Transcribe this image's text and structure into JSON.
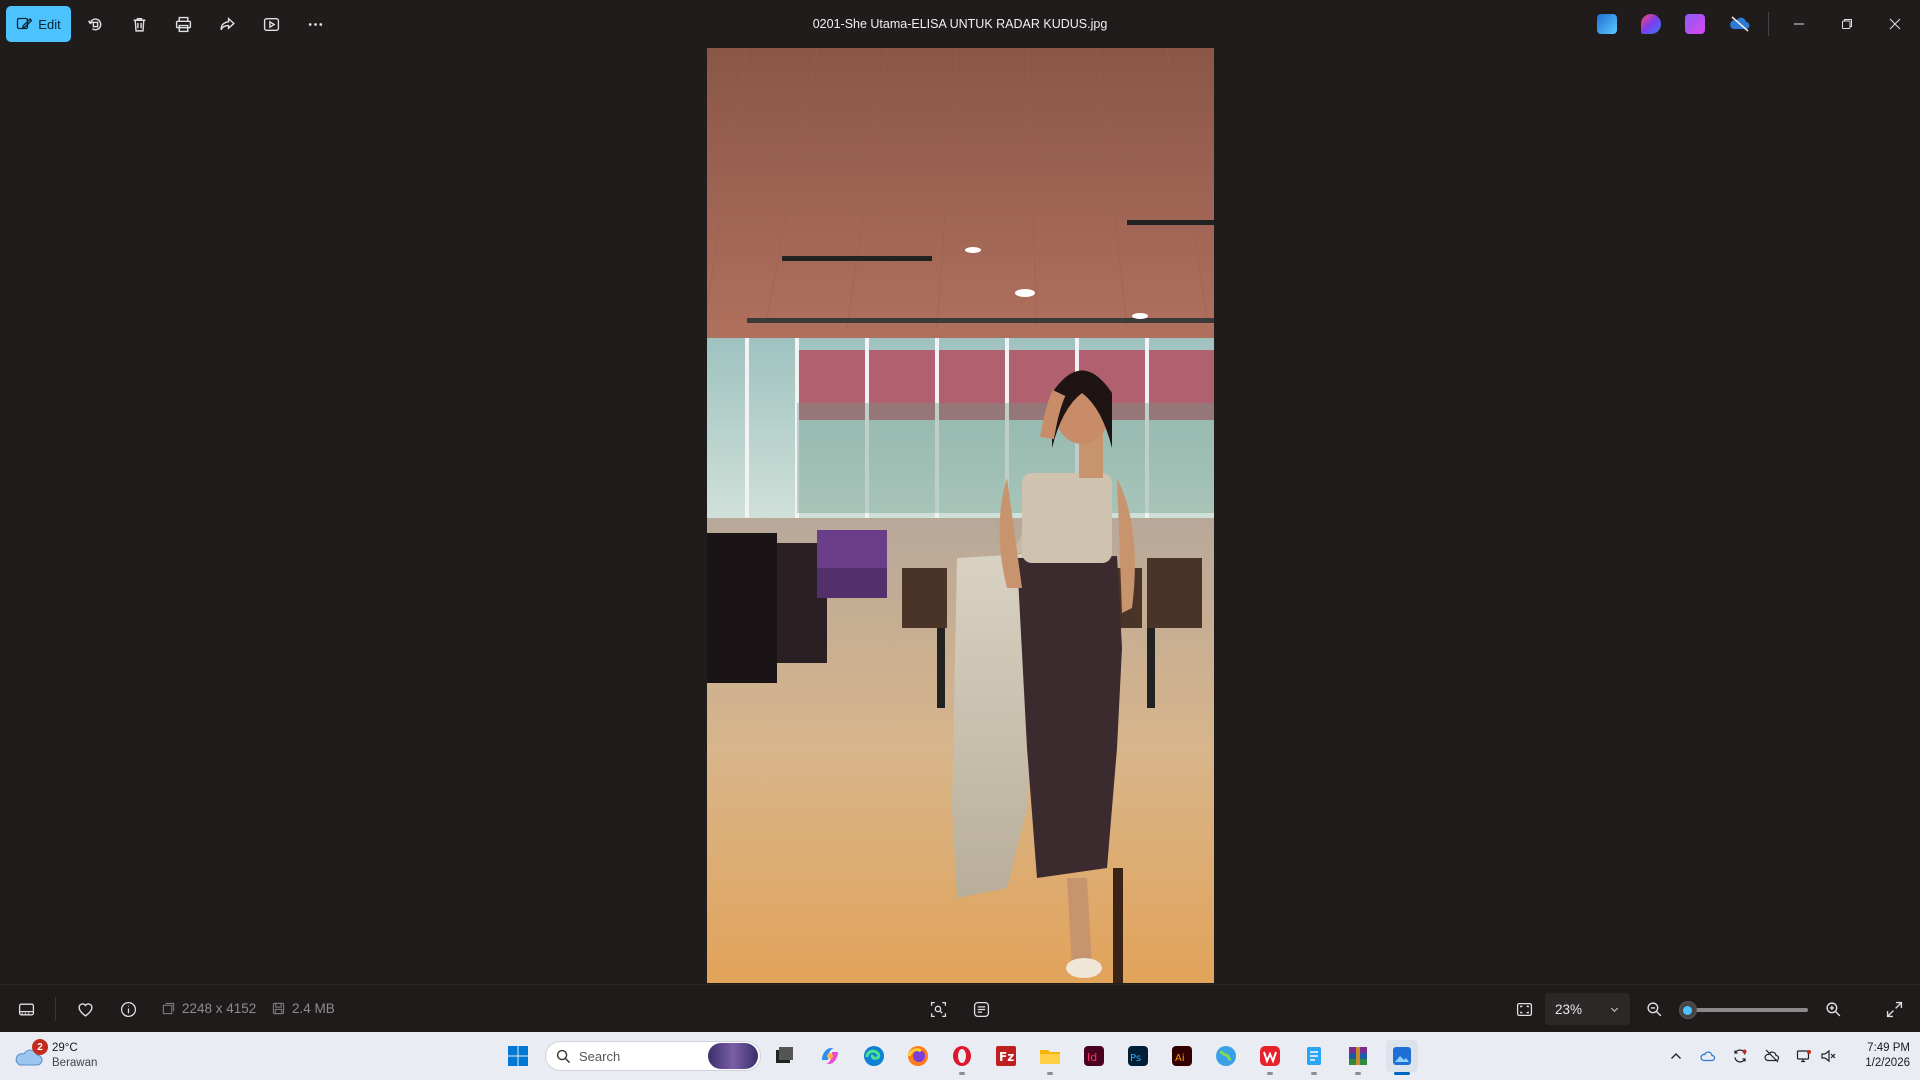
{
  "toolbar": {
    "edit_label": "Edit",
    "file_title": "0201-She Utama-ELISA UNTUK RADAR KUDUS.jpg"
  },
  "statusbar": {
    "dimensions": "2248 x 4152",
    "file_size": "2.4 MB",
    "zoom_value": "23%",
    "zoom_slider_fraction": 0.06
  },
  "taskbar": {
    "weather": {
      "temperature": "29°C",
      "condition": "Berawan",
      "badge_count": "2"
    },
    "search_placeholder": "Search",
    "clock": {
      "time": "7:49 PM",
      "date": "1/2/2026"
    }
  },
  "colors": {
    "accent": "#4cc2ff",
    "background": "#201c1c",
    "taskbar_bg": "#e9edf3"
  }
}
